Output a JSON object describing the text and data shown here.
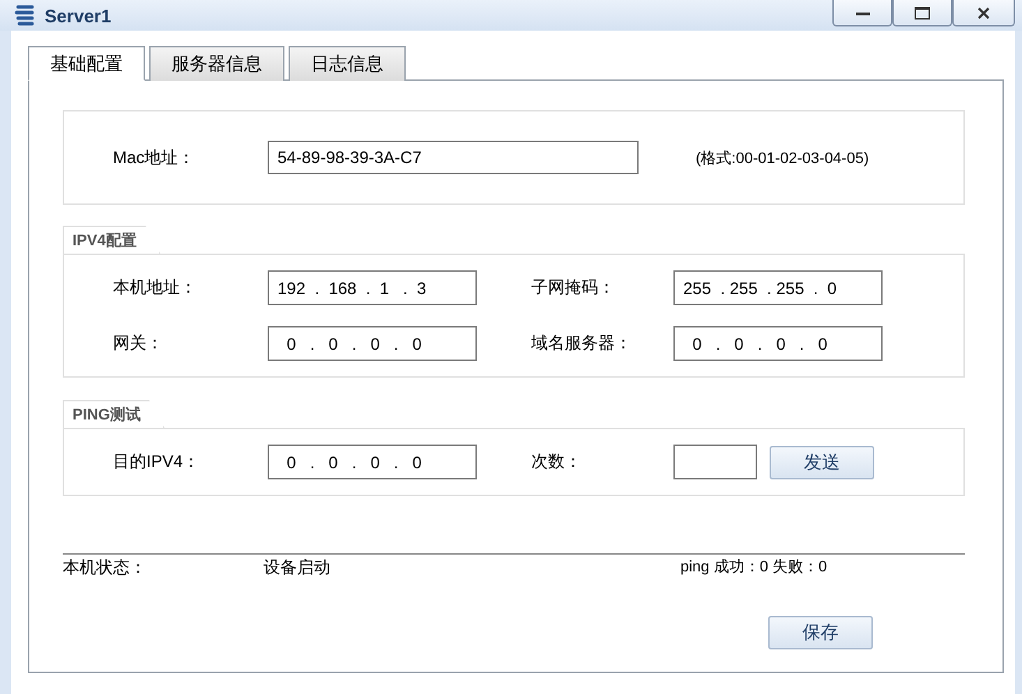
{
  "window": {
    "title": "Server1"
  },
  "tabs": [
    {
      "label": "基础配置",
      "selected": true
    },
    {
      "label": "服务器信息",
      "selected": false
    },
    {
      "label": "日志信息",
      "selected": false
    }
  ],
  "mac": {
    "label": "Mac地址：",
    "value": "54-89-98-39-3A-C7",
    "hint": "(格式:00-01-02-03-04-05)"
  },
  "ipv4": {
    "title": "IPV4配置",
    "fields": [
      {
        "label": "本机地址：",
        "value": "192  .  168  .  1   .  3"
      },
      {
        "label": "子网掩码：",
        "value": "255  . 255  . 255  .  0"
      },
      {
        "label": "网关：",
        "value": "  0   .   0   .   0   .   0"
      },
      {
        "label": "域名服务器：",
        "value": "  0   .   0   .   0   .   0"
      }
    ]
  },
  "ping": {
    "title": "PING测试",
    "target": {
      "label": "目的IPV4：",
      "value": "  0   .   0   .   0   .   0"
    },
    "count": {
      "label": "次数："
    },
    "send_button": "发送"
  },
  "status": {
    "label": "本机状态：",
    "value": "设备启动",
    "result": "ping 成功：0 失败：0"
  },
  "save_button": "保存"
}
